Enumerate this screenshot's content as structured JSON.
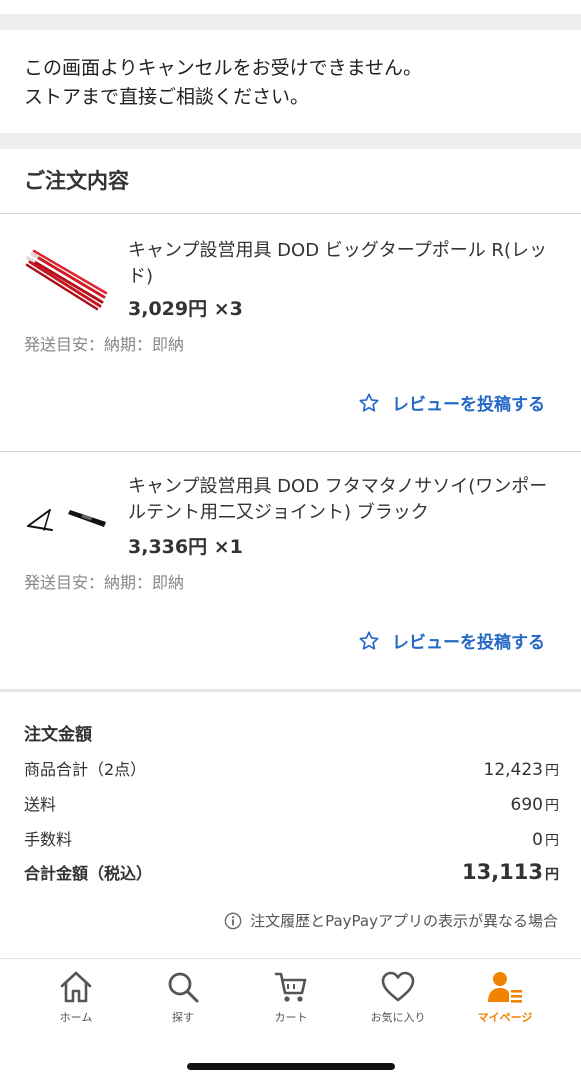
{
  "notice": {
    "line1": "この画面よりキャンセルをお受けできません。",
    "line2": "ストアまで直接ご相談ください。"
  },
  "order_section_title": "ご注文内容",
  "items": [
    {
      "name": "キャンプ設営用具 DOD ビッグタープポール R(レッド)",
      "price": "3,029円",
      "qty": "×3",
      "shipping": "発送目安：納期：即納",
      "review_label": "レビューを投稿する",
      "thumb_icon": "red-tarp-poles-image"
    },
    {
      "name": "キャンプ設営用具 DOD フタマタノサソイ(ワンポールテント用二又ジョイント) ブラック",
      "price": "3,336円",
      "qty": "×1",
      "shipping": "発送目安：納期：即納",
      "review_label": "レビューを投稿する",
      "thumb_icon": "black-joint-image"
    }
  ],
  "summary": {
    "title": "注文金額",
    "rows": [
      {
        "label": "商品合計（2点）",
        "value": "12,423",
        "unit": "円"
      },
      {
        "label": "送料",
        "value": "690",
        "unit": "円"
      },
      {
        "label": "手数料",
        "value": "0",
        "unit": "円"
      }
    ],
    "total": {
      "label": "合計金額（税込）",
      "value": "13,113",
      "unit": "円"
    },
    "note": "注文履歴とPayPayアプリの表示が異なる場合"
  },
  "tabbar": {
    "tabs": [
      {
        "label": "ホーム",
        "icon": "home-icon"
      },
      {
        "label": "探す",
        "icon": "search-icon"
      },
      {
        "label": "カート",
        "icon": "cart-icon"
      },
      {
        "label": "お気に入り",
        "icon": "heart-icon"
      },
      {
        "label": "マイページ",
        "icon": "mypage-icon"
      }
    ],
    "active_color": "#f08300"
  },
  "colors": {
    "link": "#2468c8",
    "band": "#efefef"
  }
}
